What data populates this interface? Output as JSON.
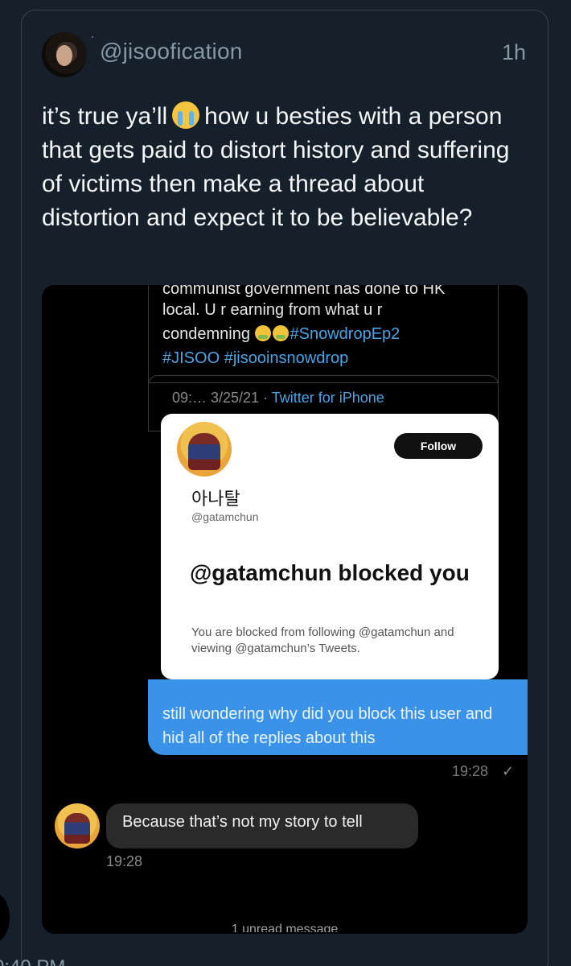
{
  "tweet": {
    "handle": "@jisoofication",
    "time": "1h",
    "text_before_emoji": "it’s true ya’ll",
    "text_after_emoji": "how u besties with a person that gets paid to distort history and suffering of victims then make a thread about distortion and expect it to be believable?"
  },
  "screenshot": {
    "quoted": {
      "cut_line": "communist government has done to HK",
      "line1": "local. U r earning from what u r",
      "line2_prefix": "condemning",
      "hashtag1": "#SnowdropEp2",
      "hashtag2": "#JISOO",
      "hashtag3": "#jisooinsnowdrop"
    },
    "meta": {
      "date": "09:… 3/25/21 · ",
      "source": "Twitter for iPhone"
    },
    "profile_card": {
      "name": "아나탈",
      "handle": "@gatamchun",
      "follow_label": "Follow",
      "headline": "@gatamchun blocked you",
      "description": "You are blocked from following @gatamchun and viewing @gatamchun’s Tweets."
    },
    "outgoing_message": {
      "text": "still wondering why did you block this user and hid all of the replies about this",
      "time": "19:28",
      "check": "✓"
    },
    "incoming_message": {
      "text": "Because that’s not my story to tell",
      "time": "19:28"
    },
    "unread_label": "1 unread message"
  },
  "footer": {
    "partial_time": "0:40 PM"
  }
}
